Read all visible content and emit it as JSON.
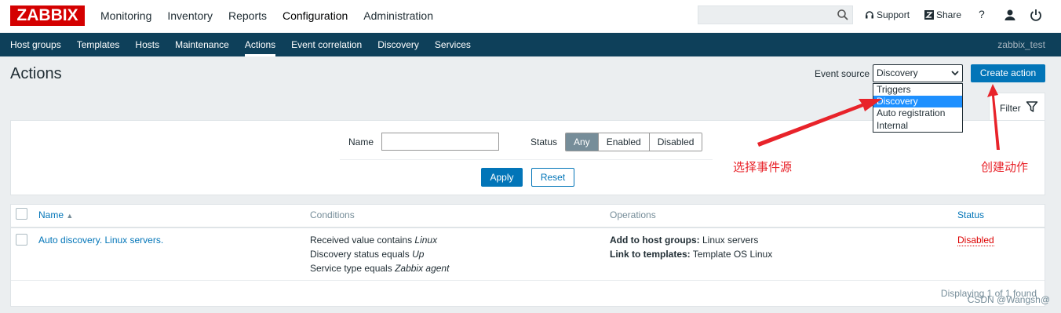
{
  "brand": {
    "logo": "ZABBIX"
  },
  "main_nav": [
    {
      "label": "Monitoring"
    },
    {
      "label": "Inventory"
    },
    {
      "label": "Reports"
    },
    {
      "label": "Configuration",
      "active": true
    },
    {
      "label": "Administration"
    }
  ],
  "top_links": {
    "support": "Support",
    "share": "Share",
    "help": "?"
  },
  "sub_nav": [
    {
      "label": "Host groups"
    },
    {
      "label": "Templates"
    },
    {
      "label": "Hosts"
    },
    {
      "label": "Maintenance"
    },
    {
      "label": "Actions",
      "active": true
    },
    {
      "label": "Event correlation"
    },
    {
      "label": "Discovery"
    },
    {
      "label": "Services"
    }
  ],
  "server_name": "zabbix_test",
  "page": {
    "title": "Actions",
    "event_source_label": "Event source",
    "event_source_value": "Discovery",
    "create_button": "Create action"
  },
  "event_source_options": [
    "Triggers",
    "Discovery",
    "Auto registration",
    "Internal"
  ],
  "filter": {
    "tab_label": "Filter",
    "name_label": "Name",
    "name_value": "",
    "status_label": "Status",
    "status_options": [
      "Any",
      "Enabled",
      "Disabled"
    ],
    "status_selected": "Any",
    "apply": "Apply",
    "reset": "Reset"
  },
  "table": {
    "headers": {
      "name": "Name",
      "conditions": "Conditions",
      "operations": "Operations",
      "status": "Status"
    },
    "sort_indicator": "▲",
    "rows": [
      {
        "name": "Auto discovery. Linux servers.",
        "conditions": [
          {
            "text": "Received value contains ",
            "em": "Linux"
          },
          {
            "text": "Discovery status equals ",
            "em": "Up"
          },
          {
            "text": "Service type equals ",
            "em": "Zabbix agent"
          }
        ],
        "operations": [
          {
            "bold": "Add to host groups:",
            "text": " Linux servers"
          },
          {
            "bold": "Link to templates:",
            "text": " Template OS Linux"
          }
        ],
        "status": "Disabled"
      }
    ],
    "footer": "Displaying 1 of 1 found"
  },
  "annotations": {
    "select_event_source": "选择事件源",
    "create_action": "创建动作"
  },
  "watermark": "CSDN @Wangsh@",
  "colors": {
    "brand_red": "#d40000",
    "nav_dark": "#0e405a",
    "link_blue": "#0275b8",
    "danger_red": "#dc0000",
    "annotation_red": "#e8232a",
    "highlight": "#1e90ff"
  }
}
